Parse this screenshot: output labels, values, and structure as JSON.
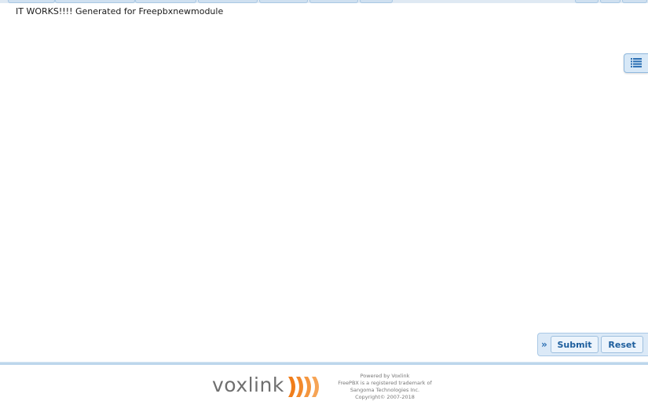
{
  "page": {
    "message": "IT WORKS!!!! Generated for Freepbxnewmodule"
  },
  "action_bar": {
    "submit_label": "Submit",
    "reset_label": "Reset"
  },
  "footer": {
    "logo_text": "voxlink",
    "powered_by": "Powered by Voxlink",
    "trademark_line1": "FreePBX is a registered trademark of",
    "trademark_line2": "Sangoma Technologies Inc.",
    "copyright": "Copyright© 2007-2018"
  },
  "icons": {
    "side_toggle": "list-icon",
    "collapse": "double-chevron-right-icon"
  },
  "colors": {
    "accent": "#2c6fb3",
    "button_bg": "#ecf4fc",
    "logo_orange": "#f07d1a"
  }
}
